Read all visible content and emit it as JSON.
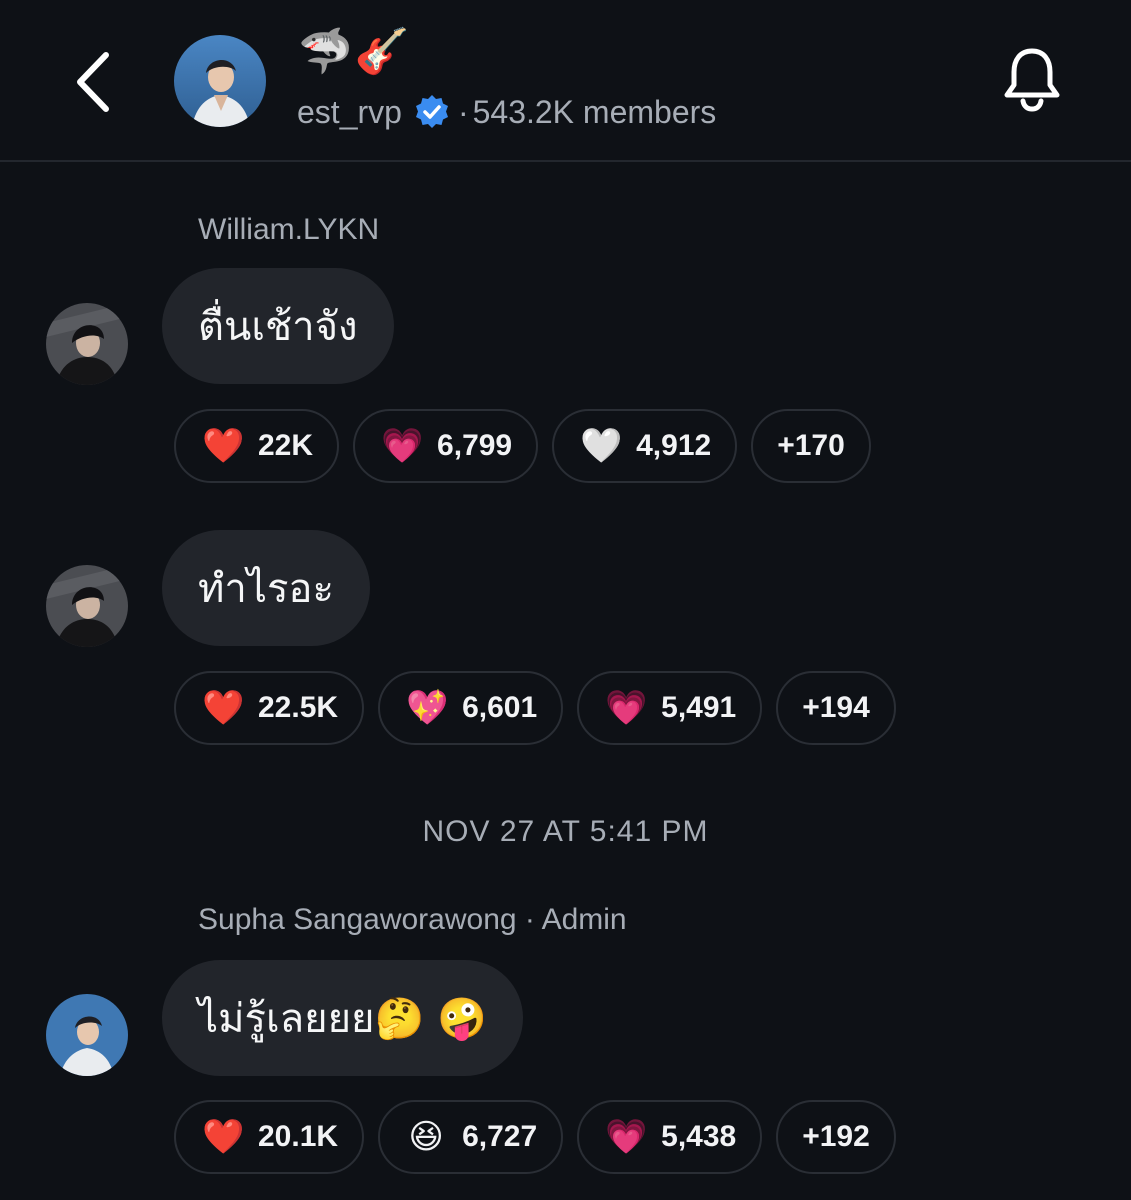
{
  "header": {
    "channel_emojis": "🦈🎸",
    "channel_name": "est_rvp",
    "separator": "·",
    "members": "543.2K members",
    "back_icon": "chevron-left-icon",
    "bell_icon": "bell-icon",
    "verified_color": "#3a8cf0"
  },
  "messages": [
    {
      "sender": "William.LYKN",
      "text": "ตื่นเช้าจัง",
      "reactions": [
        {
          "emoji": "❤️",
          "count": "22K"
        },
        {
          "emoji": "💗",
          "count": "6,799"
        },
        {
          "emoji": "🤍",
          "count": "4,912"
        },
        {
          "count": "+170"
        }
      ]
    },
    {
      "text": "ทำไรอะ",
      "reactions": [
        {
          "emoji": "❤️",
          "count": "22.5K"
        },
        {
          "emoji": "💖",
          "count": "6,601"
        },
        {
          "emoji": "💗",
          "count": "5,491"
        },
        {
          "count": "+194"
        }
      ]
    },
    {
      "sender": "Supha Sangaworawong · Admin",
      "text": "ไม่รู้เลยยย🤔 🤪",
      "reactions": [
        {
          "emoji": "❤️",
          "count": "20.1K"
        },
        {
          "emoji": "😆",
          "count": "6,727"
        },
        {
          "emoji": "💗",
          "count": "5,438"
        },
        {
          "count": "+192"
        }
      ]
    }
  ],
  "date_separator": "NOV 27 AT 5:41 PM",
  "colors": {
    "background": "#0e1116",
    "bubble": "#22252b",
    "muted_text": "#a7adb6"
  }
}
